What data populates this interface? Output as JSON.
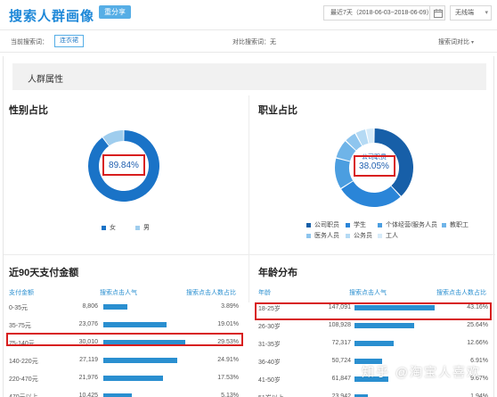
{
  "header": {
    "title": "搜索人群画像",
    "badge": "重分享",
    "date_range": "最近7天（2018-06-03~2018-06-09）",
    "terminal": "无线端"
  },
  "filters": {
    "current_label": "当前搜索词：",
    "current_keyword": "连衣裙",
    "compare_label": "对比搜索词：无",
    "search_compare": "搜索词对比"
  },
  "section": {
    "title": "人群属性"
  },
  "gender": {
    "title": "性别占比",
    "center_label": "女",
    "center_value": "89.84%",
    "legend": [
      {
        "label": "女",
        "color": "#1a73c7"
      },
      {
        "label": "男",
        "color": "#9fcdee"
      }
    ],
    "chart_data": {
      "type": "pie",
      "labels": [
        "女",
        "男"
      ],
      "values": [
        89.84,
        10.16
      ],
      "colors": [
        "#1a73c7",
        "#9fcdee"
      ]
    }
  },
  "occupation": {
    "title": "职业占比",
    "center_label": "公司职员",
    "center_value": "38.05%",
    "legend": [
      {
        "label": "公司职员",
        "color": "#175fa8"
      },
      {
        "label": "学生",
        "color": "#2a85d8"
      },
      {
        "label": "个体经营/服务人员",
        "color": "#4b9ee0"
      },
      {
        "label": "教职工",
        "color": "#6fb4e8"
      },
      {
        "label": "医务人员",
        "color": "#8ec5ee"
      },
      {
        "label": "公务员",
        "color": "#b5daf4"
      },
      {
        "label": "工人",
        "color": "#d6ebf9"
      }
    ],
    "chart_data": {
      "type": "pie",
      "labels": [
        "公司职员",
        "学生",
        "个体经营/服务人员",
        "教职工",
        "医务人员",
        "公务员",
        "工人"
      ],
      "values": [
        38.05,
        28,
        13,
        8,
        5,
        4.5,
        3.45
      ],
      "colors": [
        "#175fa8",
        "#2a85d8",
        "#4b9ee0",
        "#6fb4e8",
        "#8ec5ee",
        "#b5daf4",
        "#d6ebf9"
      ]
    }
  },
  "payment": {
    "title": "近90天支付金额",
    "columns": [
      "支付金额",
      "搜索点击人气",
      "搜索点击人数占比"
    ],
    "chart_data": {
      "type": "bar",
      "categories": [
        "0-35元",
        "35-75元",
        "75-140元",
        "140-220元",
        "220-470元",
        "470元以上"
      ],
      "values": [
        8806,
        23076,
        30010,
        27119,
        21976,
        10425
      ],
      "percents": [
        "3.89%",
        "19.01%",
        "29.53%",
        "24.91%",
        "17.53%",
        "5.13%"
      ],
      "value_labels": [
        "8,806",
        "23,076",
        "30,010",
        "27,119",
        "21,976",
        "10,425"
      ]
    }
  },
  "age": {
    "title": "年龄分布",
    "columns": [
      "年龄",
      "搜索点击人气",
      "搜索点击人数占比"
    ],
    "chart_data": {
      "type": "bar",
      "categories": [
        "18-25岁",
        "26-30岁",
        "31-35岁",
        "36-40岁",
        "41-50岁",
        "51岁以上"
      ],
      "values": [
        147091,
        108928,
        72317,
        50724,
        61847,
        23942
      ],
      "percents": [
        "43.16%",
        "25.64%",
        "12.66%",
        "6.91%",
        "9.67%",
        "1.94%"
      ],
      "value_labels": [
        "147,091",
        "108,928",
        "72,317",
        "50,724",
        "61,847",
        "23,942"
      ]
    }
  },
  "watermark": "知乎 @淘宝人喜欢"
}
